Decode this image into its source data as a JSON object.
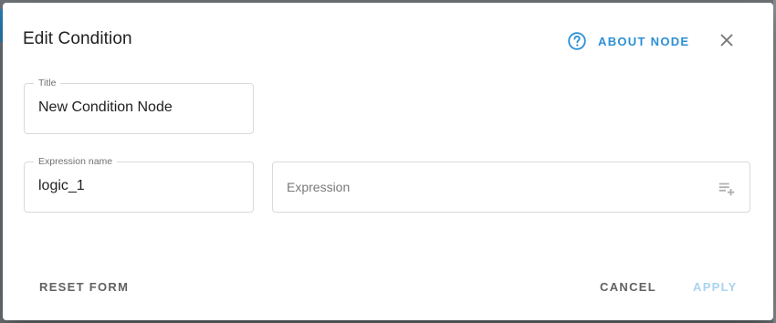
{
  "dialog": {
    "title": "Edit Condition",
    "about_label": "ABOUT NODE",
    "icons": {
      "help": "help-circle-outline-icon",
      "close": "close-icon",
      "expression_add": "playlist-add-icon"
    },
    "accent_color": "#2c8fd6"
  },
  "form": {
    "title_field": {
      "label": "Title",
      "value": "New Condition Node"
    },
    "expression_name_field": {
      "label": "Expression name",
      "value": "logic_1"
    },
    "expression_field": {
      "placeholder": "Expression"
    }
  },
  "footer": {
    "reset_label": "RESET FORM",
    "cancel_label": "CANCEL",
    "apply_label": "APPLY",
    "apply_disabled": true
  }
}
